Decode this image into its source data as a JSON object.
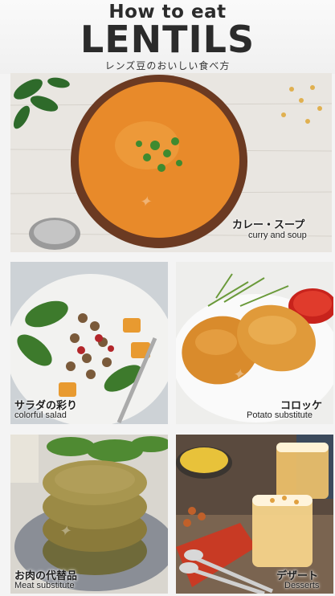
{
  "header": {
    "title_top": "How to eat",
    "title_main": "LENTILS",
    "subtitle": "レンズ豆のおいしい食べ方"
  },
  "panels": {
    "soup": {
      "jp": "カレー・スープ",
      "en": "curry and soup"
    },
    "salad": {
      "jp": "サラダの彩り",
      "en": "colorful salad"
    },
    "croquette": {
      "jp": "コロッケ",
      "en": "Potato substitute"
    },
    "burger": {
      "jp": "お肉の代替品",
      "en": "Meat substitute"
    },
    "dessert": {
      "jp": "デザート",
      "en": "Desserts"
    }
  },
  "colors": {
    "heading": "#2b2b2b",
    "soup": "#e88a2a",
    "croquette": "#d98b2c",
    "burger": "#8a7a3a",
    "dessert": "#f2c46b"
  }
}
